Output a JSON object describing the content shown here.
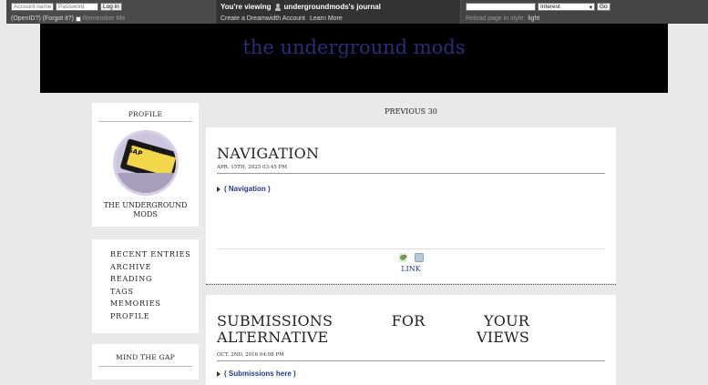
{
  "topbar": {
    "login": {
      "account_placeholder": "Account name:",
      "password_placeholder": "Password",
      "login_button": "Log in",
      "openid_link": "(OpenID?)",
      "forgot_link": "(Forgot it?)",
      "remember_label": "Remember Me"
    },
    "journal": {
      "viewing_prefix": "You're viewing",
      "journal_name": "undergroundmods's journal",
      "create_link": "Create a Dreamwidth Account",
      "learn_link": "Learn More"
    },
    "search": {
      "search_value": "",
      "select_value": "Interest",
      "go_button": "Go",
      "reload_label": "Reload page in style:",
      "light_link": "light"
    }
  },
  "header": {
    "title": "the underground mods"
  },
  "sidebar": {
    "profile": {
      "title": "PROFILE",
      "name": "THE UNDERGROUND MODS",
      "userpic_text": "MIND THE GAP"
    },
    "nav": [
      {
        "label": "RECENT ENTRIES"
      },
      {
        "label": "ARCHIVE"
      },
      {
        "label": "READING"
      },
      {
        "label": "TAGS"
      },
      {
        "label": "MEMORIES"
      },
      {
        "label": "PROFILE"
      }
    ],
    "mind_the_gap": {
      "title": "MIND THE GAP"
    }
  },
  "main": {
    "previous": "PREVIOUS 30",
    "entries": [
      {
        "title": "NAVIGATION",
        "date": "APR. 15TH, 2025",
        "time": "03:45 PM",
        "cut": "( Navigation )",
        "link": "LINK"
      },
      {
        "title": "SUBMISSIONS FOR YOUR ALTERNATIVE VIEWS",
        "date": "OCT. 2ND, 2016",
        "time": "04:08 PM",
        "cut": "( Submissions here )"
      }
    ]
  }
}
